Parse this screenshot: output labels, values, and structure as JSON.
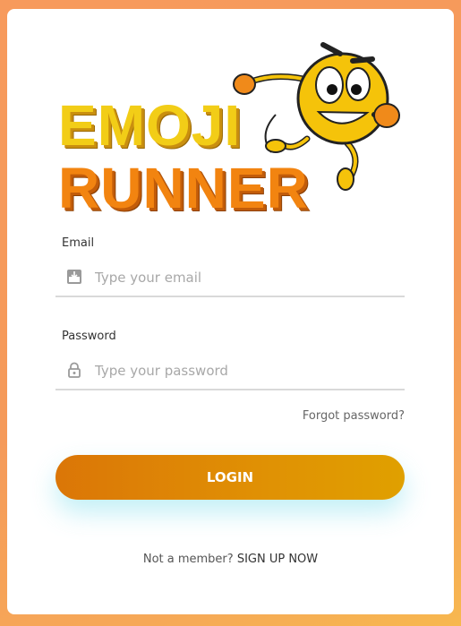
{
  "logo": {
    "line1": "EMOJI",
    "line2": "RUNNER",
    "colors": {
      "line1": "#f2cd17",
      "line2": "#f28410",
      "mascot": "#f5c30a",
      "gloves": "#f08a1a"
    },
    "mascot_icon": "running-emoji-mascot"
  },
  "form": {
    "email": {
      "label": "Email",
      "placeholder": "Type your email",
      "value": "",
      "icon": "email-icon"
    },
    "password": {
      "label": "Password",
      "placeholder": "Type your password",
      "value": "",
      "icon": "lock-icon"
    },
    "forgot_label": "Forgot password?",
    "login_label": "LOGIN"
  },
  "footer": {
    "prompt": "Not a member?",
    "signup_label": "SIGN UP NOW"
  },
  "colors": {
    "accent": "#e0860a",
    "background": "#f79a5c"
  }
}
